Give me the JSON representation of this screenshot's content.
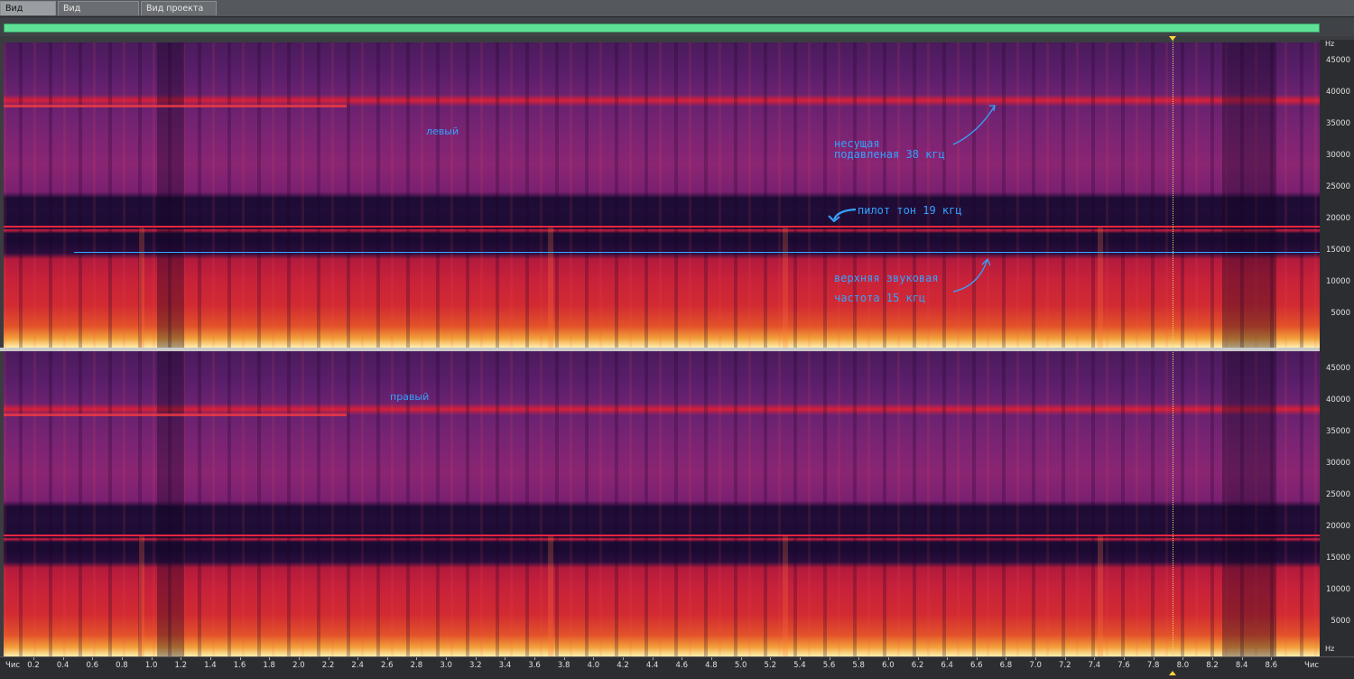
{
  "tabs": [
    {
      "label": "Вид правки",
      "active": true
    },
    {
      "label": "Вид мультитрека",
      "active": false
    },
    {
      "label": "Вид проекта CD",
      "active": false
    }
  ],
  "channels": [
    {
      "name": "левый"
    },
    {
      "name": "правый"
    }
  ],
  "annotations": {
    "carrier_line1": "несущая",
    "carrier_line2": "подавленая 38 кгц",
    "pilot": "пилот тон 19 кгц",
    "upper_line1": "верхняя звуковая",
    "upper_line2": "частота 15 кгц"
  },
  "hz_axis": {
    "unit": "Hz",
    "ticks": [
      "45000",
      "40000",
      "35000",
      "30000",
      "25000",
      "20000",
      "15000",
      "10000",
      "5000"
    ]
  },
  "time_axis": {
    "start_label": "Чис",
    "end_label": "Чис",
    "ticks": [
      "0.2",
      "0.4",
      "0.6",
      "0.8",
      "1.0",
      "1.2",
      "1.4",
      "1.6",
      "1.8",
      "2.0",
      "2.2",
      "2.4",
      "2.6",
      "2.8",
      "3.0",
      "3.2",
      "3.4",
      "3.6",
      "3.8",
      "4.0",
      "4.2",
      "4.4",
      "4.6",
      "4.8",
      "5.0",
      "5.2",
      "5.4",
      "5.6",
      "5.8",
      "6.0",
      "6.2",
      "6.4",
      "6.6",
      "6.8",
      "7.0",
      "7.2",
      "7.4",
      "7.6",
      "7.8",
      "8.0",
      "8.2",
      "8.4",
      "8.6"
    ]
  },
  "colors": {
    "overview": "#5ee196",
    "annotation": "#33a3ff",
    "pilot_line": "#e8263f",
    "cursor": "#ffd23a"
  }
}
